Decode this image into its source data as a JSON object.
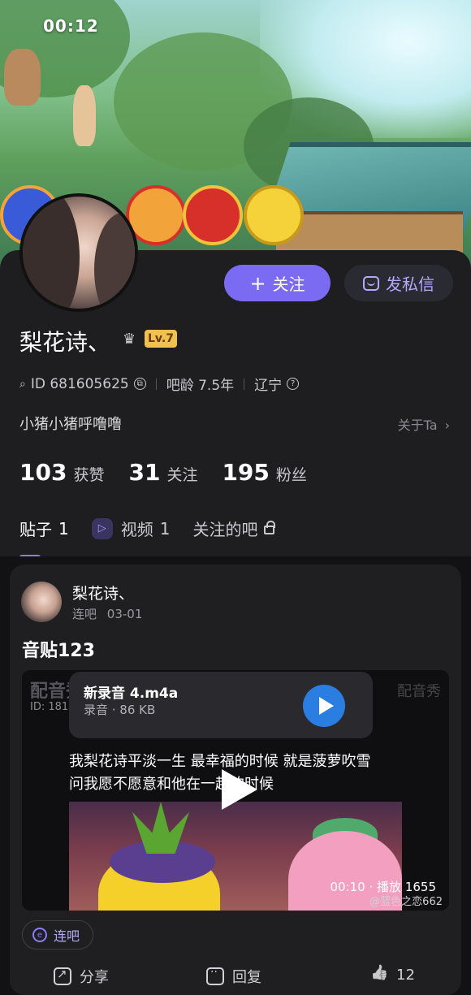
{
  "status": {
    "time": "00:12"
  },
  "profile": {
    "follow_label": "关注",
    "message_label": "发私信",
    "name": "梨花诗、",
    "level": "Lv.7",
    "id_text": "ID 681605625",
    "bar_age": "吧龄 7.5年",
    "location": "辽宁",
    "bio": "小猪小猪呼噜噜",
    "about": "关于Ta"
  },
  "stats": [
    {
      "value": "103",
      "label": "获赞"
    },
    {
      "value": "31",
      "label": "关注"
    },
    {
      "value": "195",
      "label": "粉丝"
    }
  ],
  "tabs": [
    {
      "label": "贴子",
      "count": "1",
      "active": true
    },
    {
      "label": "视频",
      "count": "1",
      "active": false
    },
    {
      "label": "关注的吧",
      "count": "",
      "active": false
    }
  ],
  "post": {
    "author": "梨花诗、",
    "forum": "连吧",
    "date": "03-01",
    "title": "音贴123",
    "watermark_app": "配音秀",
    "watermark_id": "ID: 1812735",
    "audio_name": "新录音 4.m4a",
    "audio_info": "录音 · 86 KB",
    "lyric_line1": "我梨花诗平淡一生 最幸福的时候 就是菠萝吹雪",
    "lyric_line2": "问我愿不愿意和他在一起的时候",
    "duration": "00:10",
    "plays": "播放 1655",
    "video_watermark": "@蓝色之恋662",
    "forum_chip": "连吧",
    "share_label": "分享",
    "reply_label": "回复",
    "likes": "12"
  },
  "colors": {
    "accent": "#7b6bf2",
    "background": "#1e1e21",
    "level_badge": "#f0c050",
    "play_blue": "#2a7de1"
  }
}
